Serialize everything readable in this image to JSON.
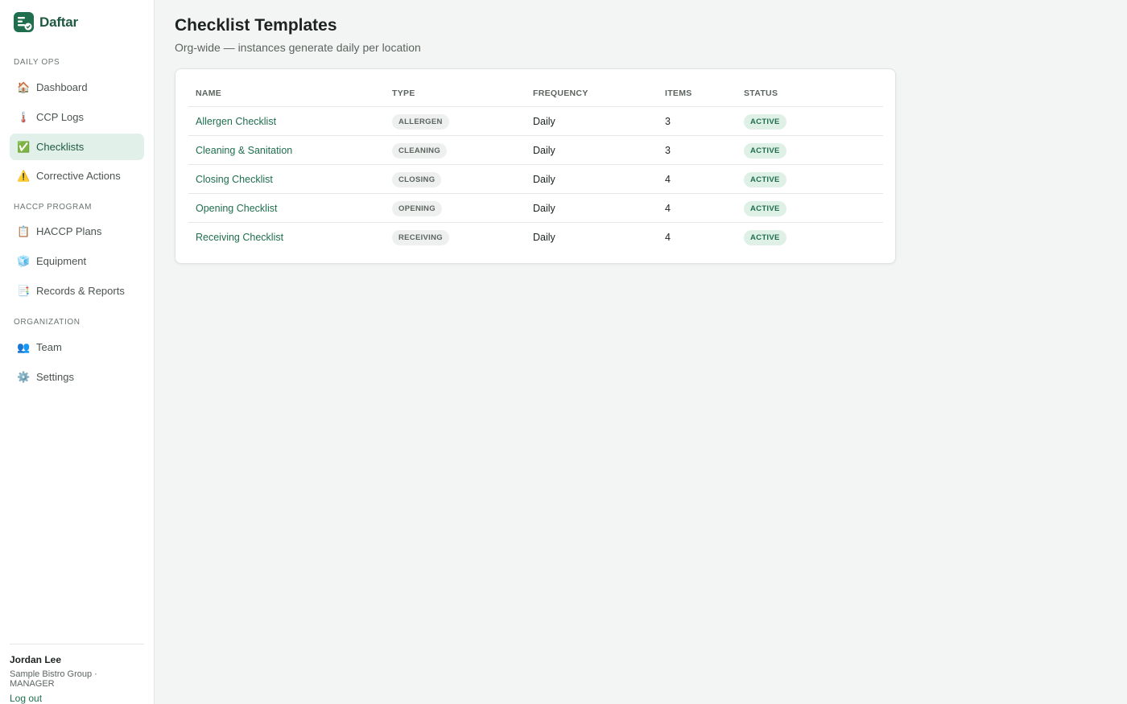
{
  "brand": {
    "name": "Daftar"
  },
  "sidebar": {
    "sections": [
      {
        "label": "DAILY OPS",
        "items": [
          {
            "label": "Dashboard",
            "icon": "🏠",
            "icon_name": "home-icon"
          },
          {
            "label": "CCP Logs",
            "icon": "🌡️",
            "icon_name": "thermometer-icon"
          },
          {
            "label": "Checklists",
            "icon": "✅",
            "icon_name": "checkmark-icon",
            "active": true
          },
          {
            "label": "Corrective Actions",
            "icon": "⚠️",
            "icon_name": "warning-icon"
          }
        ]
      },
      {
        "label": "HACCP PROGRAM",
        "items": [
          {
            "label": "HACCP Plans",
            "icon": "📋",
            "icon_name": "clipboard-icon"
          },
          {
            "label": "Equipment",
            "icon": "🧊",
            "icon_name": "ice-cube-icon"
          },
          {
            "label": "Records & Reports",
            "icon": "📑",
            "icon_name": "bookmark-tabs-icon"
          }
        ]
      },
      {
        "label": "ORGANIZATION",
        "items": [
          {
            "label": "Team",
            "icon": "👥",
            "icon_name": "people-icon"
          },
          {
            "label": "Settings",
            "icon": "⚙️",
            "icon_name": "gear-icon"
          }
        ]
      }
    ]
  },
  "user": {
    "name": "Jordan Lee",
    "org": "Sample Bistro Group · MANAGER",
    "logout_label": "Log out"
  },
  "page": {
    "title": "Checklist Templates",
    "subtitle": "Org-wide — instances generate daily per location"
  },
  "table": {
    "headers": {
      "name": "NAME",
      "type": "TYPE",
      "frequency": "FREQUENCY",
      "items": "ITEMS",
      "status": "STATUS"
    },
    "rows": [
      {
        "name": "Allergen Checklist",
        "type": "ALLERGEN",
        "frequency": "Daily",
        "items": "3",
        "status": "ACTIVE"
      },
      {
        "name": "Cleaning & Sanitation",
        "type": "CLEANING",
        "frequency": "Daily",
        "items": "3",
        "status": "ACTIVE"
      },
      {
        "name": "Closing Checklist",
        "type": "CLOSING",
        "frequency": "Daily",
        "items": "4",
        "status": "ACTIVE"
      },
      {
        "name": "Opening Checklist",
        "type": "OPENING",
        "frequency": "Daily",
        "items": "4",
        "status": "ACTIVE"
      },
      {
        "name": "Receiving Checklist",
        "type": "RECEIVING",
        "frequency": "Daily",
        "items": "4",
        "status": "ACTIVE"
      }
    ]
  },
  "colors": {
    "brand": "#1f6e4e",
    "active_nav_bg": "#e1f0e8",
    "status_active_bg": "#dff0e7",
    "type_pill_bg": "#eef0ef"
  }
}
